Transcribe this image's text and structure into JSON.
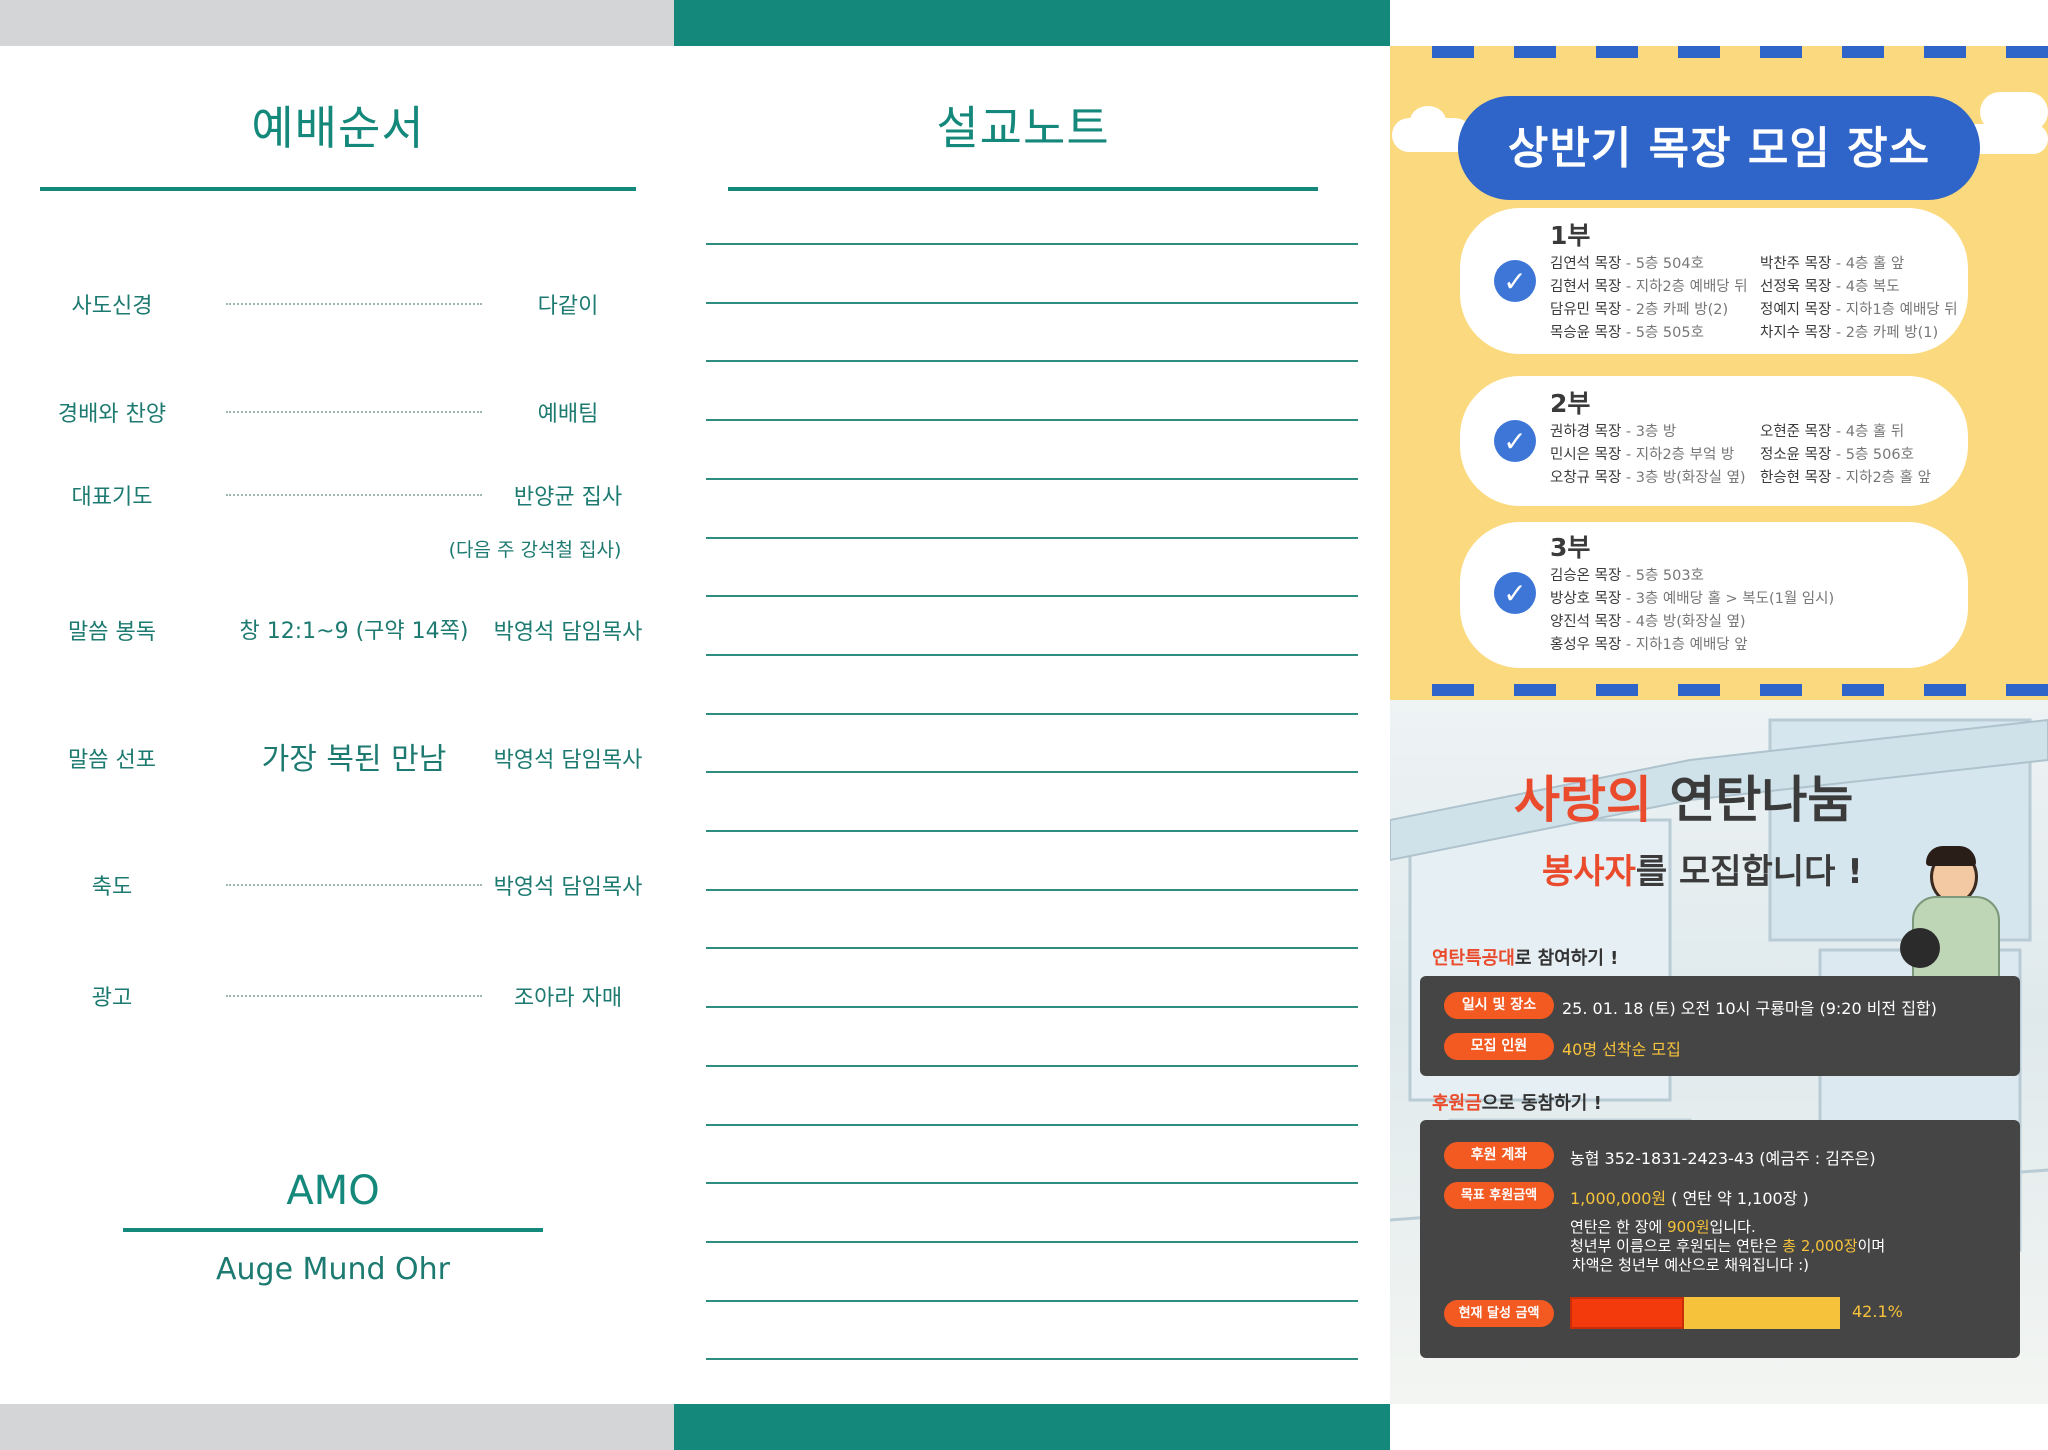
{
  "worship": {
    "title": "예배순서",
    "items": [
      {
        "label": "사도신경",
        "middle": "",
        "person": "다같이",
        "note": ""
      },
      {
        "label": "경배와 찬양",
        "middle": "",
        "person": "예배팀",
        "note": ""
      },
      {
        "label": "대표기도",
        "middle": "",
        "person": "반양균 집사",
        "note": "(다음 주 강석철 집사)"
      },
      {
        "label": "말씀 봉독",
        "middle": "창 12:1~9 (구약 14쪽)",
        "person": "박영석 담임목사",
        "note": ""
      },
      {
        "label": "말씀 선포",
        "middle": "가장 복된 만남",
        "person": "박영석 담임목사",
        "note": ""
      },
      {
        "label": "축도",
        "middle": "",
        "person": "박영석 담임목사",
        "note": ""
      },
      {
        "label": "광고",
        "middle": "",
        "person": "조아라 자매",
        "note": ""
      }
    ],
    "amo_title": "AMO",
    "amo_subtitle": "Auge Mund Ohr"
  },
  "notes": {
    "title": "설교노트"
  },
  "gathering": {
    "title": "상반기 목장 모임 장소",
    "parts": [
      {
        "name": "1부",
        "left": [
          {
            "leader": "김연석 목장",
            "place": " - 5층 504호"
          },
          {
            "leader": "김현서 목장",
            "place": " - 지하2층 예배당 뒤"
          },
          {
            "leader": "담유민 목장",
            "place": " - 2층 카페 방(2)"
          },
          {
            "leader": "목승윤 목장",
            "place": " - 5층 505호"
          }
        ],
        "right": [
          {
            "leader": "박찬주 목장",
            "place": " - 4층 홀 앞"
          },
          {
            "leader": "선정욱 목장",
            "place": " - 4층 복도"
          },
          {
            "leader": "정예지 목장",
            "place": " - 지하1층 예배당 뒤"
          },
          {
            "leader": "차지수 목장",
            "place": " - 2층 카페 방(1)"
          }
        ]
      },
      {
        "name": "2부",
        "left": [
          {
            "leader": "권하경 목장",
            "place": " - 3층 방"
          },
          {
            "leader": "민시은 목장",
            "place": " - 지하2층 부엌 방"
          },
          {
            "leader": "오창규 목장",
            "place": " - 3층 방(화장실 옆)"
          }
        ],
        "right": [
          {
            "leader": "오현준 목장",
            "place": " - 4층 홀 뒤"
          },
          {
            "leader": "정소윤 목장",
            "place": " - 5층 506호"
          },
          {
            "leader": "한승현 목장",
            "place": " - 지하2층 홀 앞"
          }
        ]
      },
      {
        "name": "3부",
        "left": [
          {
            "leader": "김승온 목장",
            "place": " - 5층 503호"
          },
          {
            "leader": "방상호 목장",
            "place": " - 3층 예배당 홀 > 복도(1월 임시)"
          },
          {
            "leader": "양진석 목장",
            "place": " - 4층 방(화장실 옆)"
          },
          {
            "leader": "홍성우 목장",
            "place": " - 지하1층 예배당 앞"
          }
        ],
        "right": []
      }
    ]
  },
  "coal": {
    "title_red": "사랑의",
    "title_dark": "연탄나눔",
    "sub_red": "봉사자",
    "sub_dark": "를 모집합니다 !",
    "join_red": "연탄특공대",
    "join_dark": "로 참여하기 !",
    "when_label": "일시 및 장소",
    "when_value": "25. 01. 18 (토) 오전 10시 구룡마을 (9:20 비전 집합)",
    "count_label": "모집 인원",
    "count_value": "40명 선착순 모집",
    "donate_red": "후원금",
    "donate_dark": "으로 동참하기 !",
    "account_label": "후원 계좌",
    "account_value": "농협 352-1831-2423-43 (예금주 : 김주은)",
    "goal_label": "목표 후원금액",
    "goal_value_yel": "1,000,000원",
    "goal_value_rest": " ( 연탄 약 1,100장 )",
    "desc1_a": "연탄은 한 장에 ",
    "desc1_b": "900원",
    "desc1_c": "입니다.",
    "desc2_a": "청년부 이름으로 후원되는 연탄은 ",
    "desc2_b": "총 2,000장",
    "desc2_c": "이며",
    "desc3": "차액은 청년부 예산으로 채워집니다 :)",
    "progress_label": "현재 달성 금액",
    "progress_text": "42.1%",
    "progress_value": 0.421
  },
  "colors": {
    "teal": "#14887a",
    "yellow": "#fbd97e",
    "blue": "#2f64c8",
    "orange": "#f25a22",
    "progress_fill": "#f23a0c",
    "progress_bg": "#f7c23b"
  }
}
